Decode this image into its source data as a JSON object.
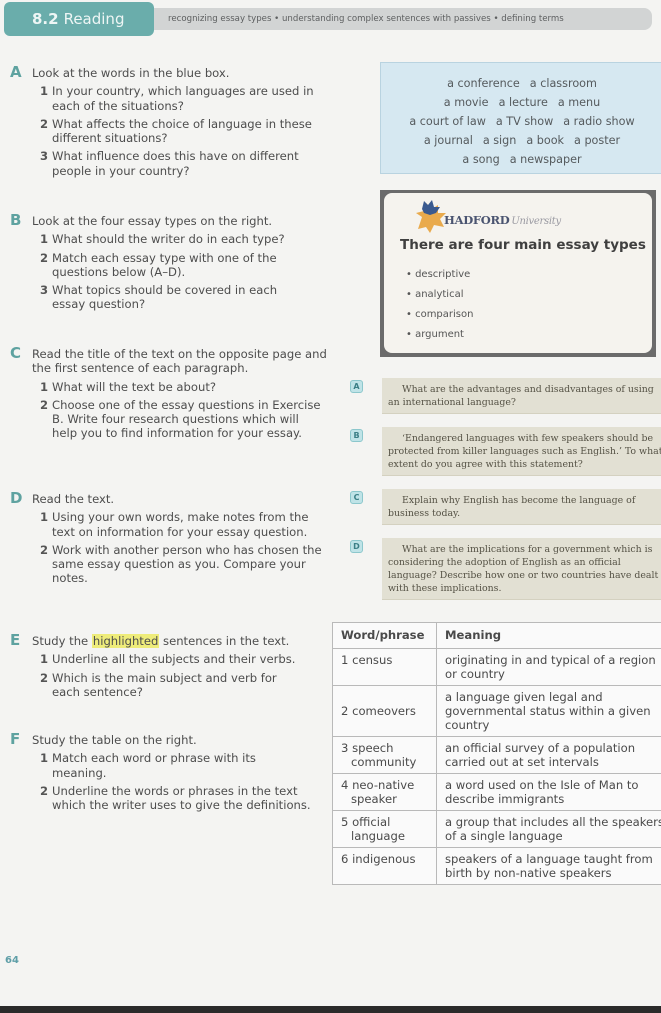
{
  "header": {
    "section_number": "8.2",
    "section_title": "Reading",
    "skills": "recognizing essay types • understanding complex sentences with passives • defining terms"
  },
  "exercises": [
    {
      "letter": "A",
      "instruction": "Look at the words in the blue box.",
      "items": [
        {
          "num": "1",
          "text": "In your country, which languages are used in each of the situations?"
        },
        {
          "num": "2",
          "text": "What affects the choice of language in these different situations?"
        },
        {
          "num": "3",
          "text": "What influence does this have on different people in your country?"
        }
      ]
    },
    {
      "letter": "B",
      "instruction": "Look at the four essay types on the right.",
      "items": [
        {
          "num": "1",
          "text": "What should the writer do in each type?"
        },
        {
          "num": "2",
          "text": "Match each essay type with one of the questions below (A–D)."
        },
        {
          "num": "3",
          "text": "What topics should be covered in each essay question?"
        }
      ]
    },
    {
      "letter": "C",
      "instruction": "Read the title of the text on the opposite page and the first sentence of each paragraph.",
      "items": [
        {
          "num": "1",
          "text": "What will the text be about?"
        },
        {
          "num": "2",
          "text": "Choose one of the essay questions in Exercise B. Write four research questions which will help you to find information for your essay."
        }
      ]
    },
    {
      "letter": "D",
      "instruction": "Read the text.",
      "items": [
        {
          "num": "1",
          "text": "Using your own words, make notes from the text on information for your essay question."
        },
        {
          "num": "2",
          "text": "Work with another person who has chosen the same essay question as you. Compare your notes."
        }
      ]
    },
    {
      "letter": "E",
      "instruction_pre": "Study the ",
      "instruction_highlight": "highlighted",
      "instruction_post": " sentences in the text.",
      "items": [
        {
          "num": "1",
          "text": "Underline all the subjects and their verbs."
        },
        {
          "num": "2",
          "text": "Which is the main subject and verb for each sentence?"
        }
      ]
    },
    {
      "letter": "F",
      "instruction": "Study the table on the right.",
      "items": [
        {
          "num": "1",
          "text": "Match each word or phrase with its meaning."
        },
        {
          "num": "2",
          "text": "Underline the words or phrases in the text which the writer uses to give the definitions."
        }
      ]
    }
  ],
  "blue_box": {
    "rows": [
      [
        "a conference",
        "a classroom"
      ],
      [
        "a movie",
        "a lecture",
        "a menu"
      ],
      [
        "a court of law",
        "a TV show",
        "a radio show"
      ],
      [
        "a journal",
        "a sign",
        "a book",
        "a poster"
      ],
      [
        "a song",
        "a newspaper"
      ]
    ]
  },
  "slide": {
    "logo_name": "HADFORD",
    "logo_sub": "University",
    "title": "There are four main essay types",
    "bullets": [
      "descriptive",
      "analytical",
      "comparison",
      "argument"
    ]
  },
  "essay_questions": [
    {
      "label": "A",
      "text": "What are the advantages and disadvantages of using an international language?"
    },
    {
      "label": "B",
      "text": "‘Endangered languages with few speakers should be protected from killer languages such as English.’ To what extent do you agree with this statement?"
    },
    {
      "label": "C",
      "text": "Explain why English has become the language of business today."
    },
    {
      "label": "D",
      "text": "What are the implications for a government which is considering the adoption of English as an official language? Describe how one or two countries have dealt with these implications."
    }
  ],
  "table": {
    "headers": [
      "Word/phrase",
      "Meaning"
    ],
    "rows": [
      {
        "num": "1",
        "word": "census",
        "word_cont": "",
        "meaning": "originating in and typical of a region or country"
      },
      {
        "num": "2",
        "word": "comeovers",
        "word_cont": "",
        "meaning": "a language given legal and governmental status within a given country"
      },
      {
        "num": "3",
        "word": "speech",
        "word_cont": "community",
        "meaning": "an official survey of a population carried out at set intervals"
      },
      {
        "num": "4",
        "word": "neo-native",
        "word_cont": "speaker",
        "meaning": "a word used on the Isle of Man to describe immigrants"
      },
      {
        "num": "5",
        "word": "official",
        "word_cont": "language",
        "meaning": "a group that includes all the speakers of a single language"
      },
      {
        "num": "6",
        "word": "indigenous",
        "word_cont": "",
        "meaning": "speakers of a language taught from birth by non-native speakers"
      }
    ]
  },
  "page_number": "64",
  "colors": {
    "accent_teal": "#6aadab",
    "letter_teal": "#5ea2a0",
    "blue_box": "#d6e8f1",
    "highlight": "#eeec7a",
    "question_card": "#e2e0d3"
  }
}
